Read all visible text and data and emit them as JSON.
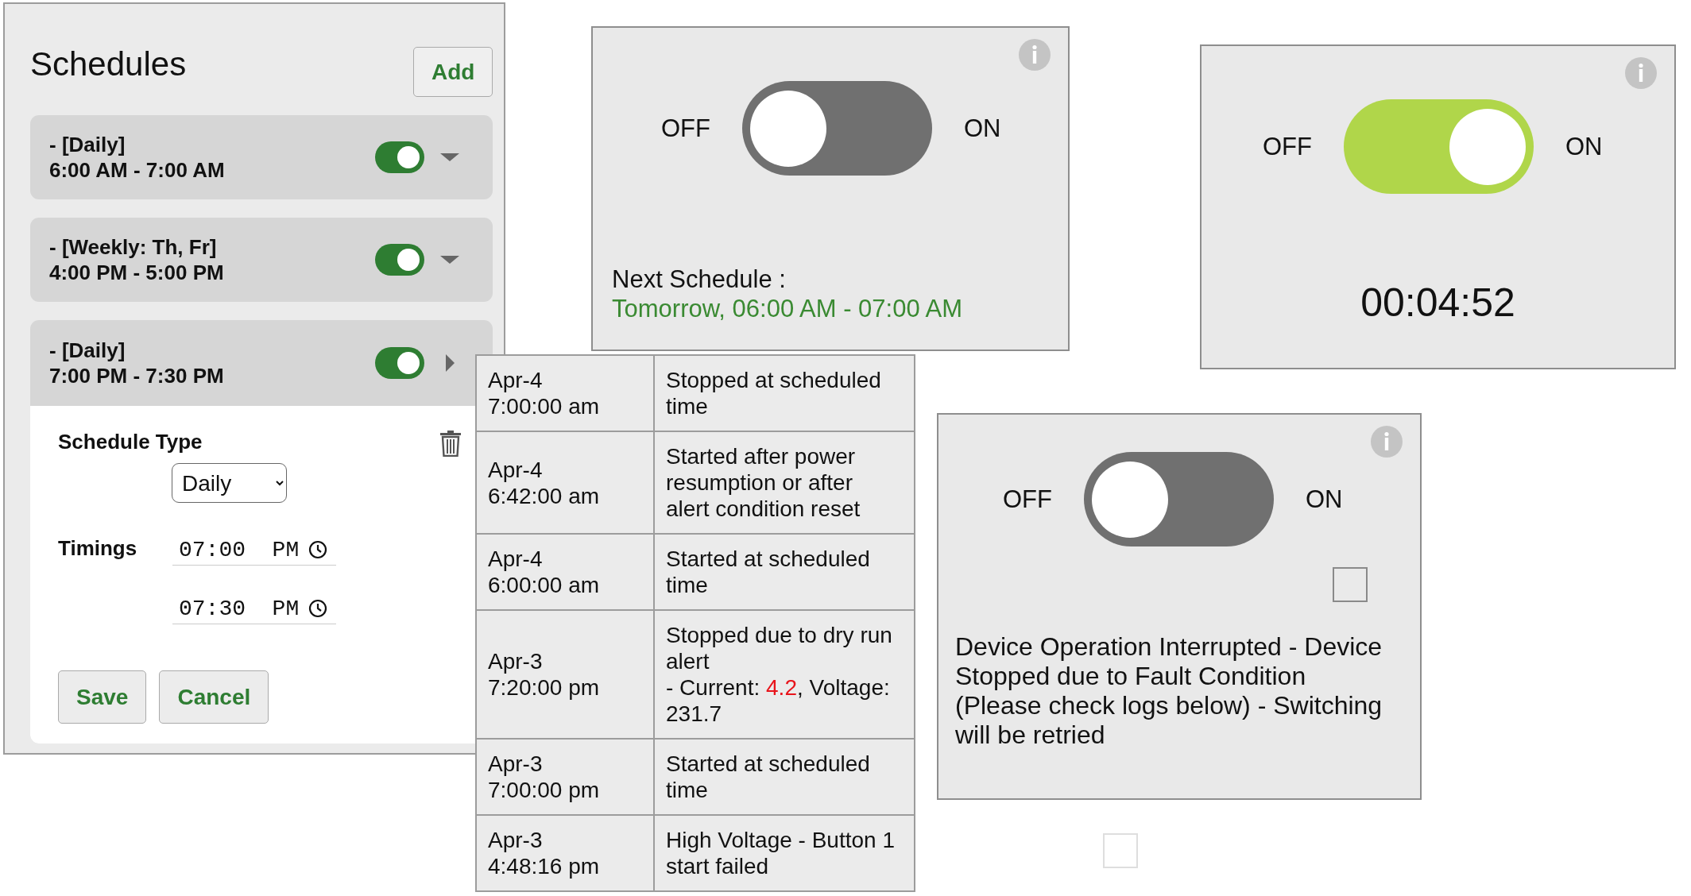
{
  "schedules_panel": {
    "title": "Schedules",
    "add_button": "Add",
    "schedules": [
      {
        "type_label": "- [Daily]",
        "time_range": "6:00 AM - 7:00 AM",
        "enabled": true,
        "expanded": false
      },
      {
        "type_label": "- [Weekly: Th, Fr]",
        "time_range": "4:00 PM - 5:00 PM",
        "enabled": true,
        "expanded": false
      },
      {
        "type_label": "- [Daily]",
        "time_range": "7:00 PM - 7:30 PM",
        "enabled": true,
        "expanded": true
      }
    ],
    "editor": {
      "schedule_type_label": "Schedule Type",
      "schedule_type": "Daily",
      "timings_label": "Timings",
      "timings": [
        "07:00  PM",
        "07:30  PM"
      ],
      "buttons": [
        "Save",
        "Cancel"
      ]
    }
  },
  "log_table": {
    "rows": [
      {
        "date": "Apr-4",
        "time": "7:00:00 am",
        "message": "Stopped at scheduled time"
      },
      {
        "date": "Apr-4",
        "time": "6:42:00 am",
        "message": "Started after power resumption or after alert condition reset"
      },
      {
        "date": "Apr-4",
        "time": "6:00:00 am",
        "message": "Started at scheduled time"
      },
      {
        "date": "Apr-3",
        "time": "7:20:00 pm",
        "message": "Stopped due to dry run alert",
        "reading": {
          "current_label": "- Current:",
          "current": "4.2",
          "voltage_label": ", Voltage:",
          "voltage": "231.7"
        }
      },
      {
        "date": "Apr-3",
        "time": "7:00:00 pm",
        "message": "Started at scheduled time"
      },
      {
        "date": "Apr-3",
        "time": "4:48:16 pm",
        "message": "High Voltage - Button 1 start failed"
      }
    ]
  },
  "device_panels": [
    {
      "kind": "next_schedule",
      "off_label": "OFF",
      "on_label": "ON",
      "on": false,
      "next_label": "Next Schedule :",
      "next_value": "Tomorrow, 06:00 AM - 07:00 AM"
    },
    {
      "kind": "timer",
      "off_label": "OFF",
      "on_label": "ON",
      "on": true,
      "timer": "00:04:52"
    },
    {
      "kind": "fault",
      "off_label": "OFF",
      "on_label": "ON",
      "on": false,
      "checked": false,
      "message": "Device Operation Interrupted - Device Stopped due to Fault Condition (Please check logs below) - Switching will be retried"
    }
  ],
  "stray_checkbox": {
    "checked": false
  }
}
